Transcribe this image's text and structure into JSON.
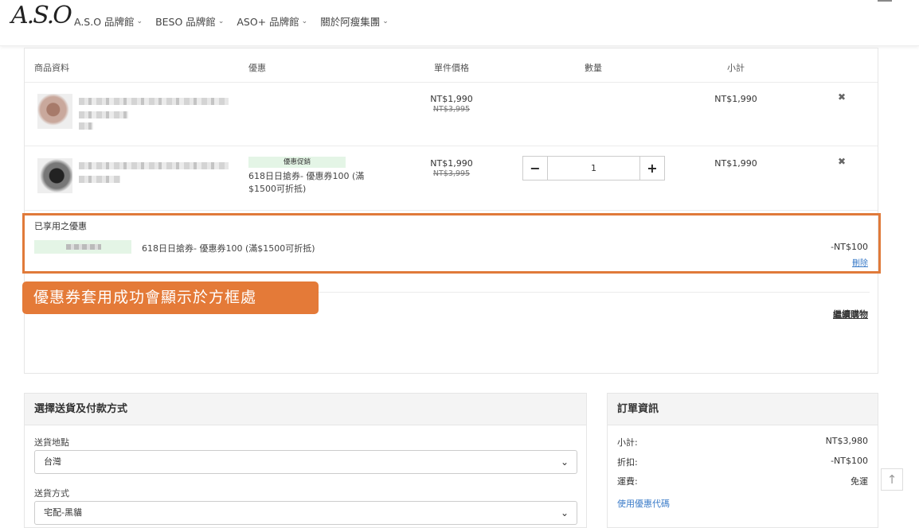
{
  "header": {
    "logo": "A.S.O",
    "nav": [
      "A.S.O 品牌館",
      "BESO 品牌館",
      "ASO+ 品牌館",
      "關於阿瘦集團"
    ]
  },
  "cart": {
    "columns": [
      "商品資料",
      "優惠",
      "單件價格",
      "數量",
      "小計"
    ],
    "rows": [
      {
        "price": "NT$1,990",
        "orig": "NT$3,995",
        "subtotal": "NT$1,990",
        "remove": "✖"
      },
      {
        "promo_tag": "優惠促銷",
        "promo_text": "618日日搶券- 優惠券100 (滿$1500可折抵)",
        "price": "NT$1,990",
        "orig": "NT$3,995",
        "qty": "1",
        "subtotal": "NT$1,990",
        "remove": "✖"
      }
    ],
    "applied": {
      "label": "已享用之優惠",
      "text": "618日日搶券- 優惠券100 (滿$1500可折抵)",
      "amount": "-NT$100",
      "remove": "刪除"
    },
    "continue": "繼續購物"
  },
  "callout": "優惠券套用成功會顯示於方框處",
  "shipping": {
    "title": "選擇送貨及付款方式",
    "location_label": "送貨地點",
    "location_value": "台灣",
    "method_label": "送貨方式",
    "method_value": "宅配-黑貓"
  },
  "order": {
    "title": "訂單資訊",
    "subtotal_label": "小計:",
    "subtotal": "NT$3,980",
    "discount_label": "折扣:",
    "discount": "-NT$100",
    "shipping_label": "運費:",
    "shipping": "免運",
    "coupon_link": "使用優惠代碼"
  }
}
